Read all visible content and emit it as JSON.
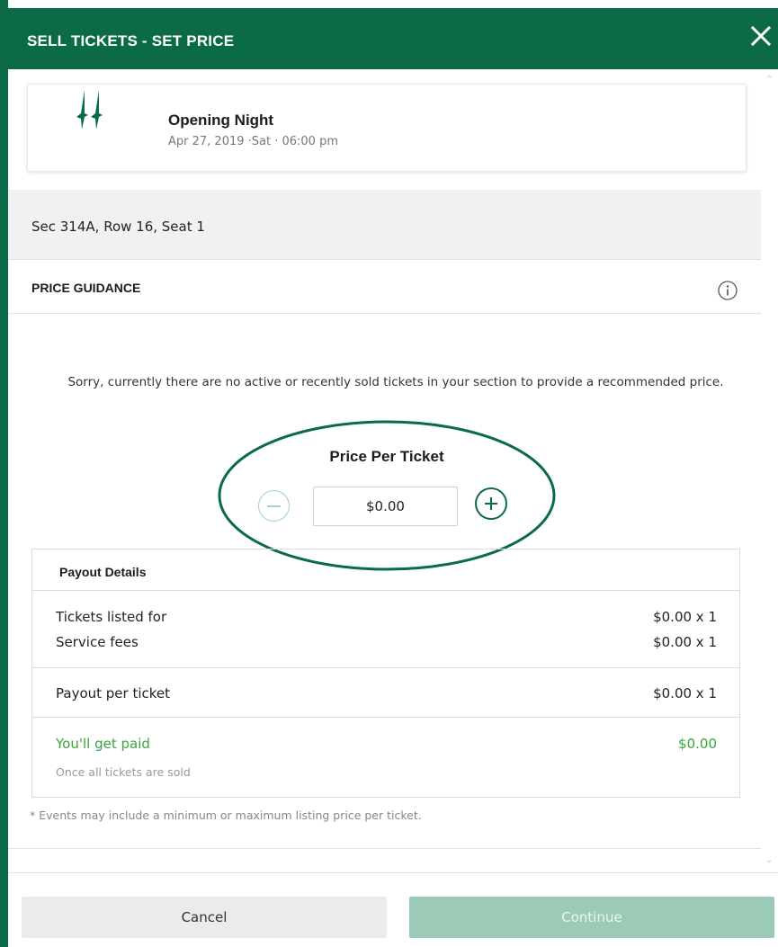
{
  "header": {
    "title": "SELL TICKETS  -  SET PRICE",
    "close_icon": "close-icon"
  },
  "event": {
    "logo": "team-logo",
    "name": "Opening Night",
    "date": "Apr 27, 2019 ·Sat · 06:00 pm"
  },
  "seat": {
    "label": "Sec 314A, Row 16, Seat 1"
  },
  "guidance": {
    "title": "PRICE GUIDANCE",
    "info_icon": "info-icon",
    "message": "Sorry, currently there are no active or recently sold tickets in your section to provide a recommended price."
  },
  "price": {
    "label": "Price Per Ticket",
    "value": "$0.00",
    "decrement_icon": "minus-circle-icon",
    "increment_icon": "plus-circle-icon"
  },
  "payout": {
    "title": "Payout Details",
    "rows": [
      {
        "label": "Tickets listed for",
        "value": "$0.00 x 1"
      },
      {
        "label": "Service fees",
        "value": "$0.00 x 1"
      },
      {
        "label": "Payout per ticket",
        "value": "$0.00 x 1"
      }
    ],
    "paid_label": "You'll get paid",
    "paid_value": "$0.00",
    "paid_note": "Once all tickets are sold"
  },
  "footnote": "* Events may include a minimum or maximum listing price per ticket.",
  "footer": {
    "cancel_label": "Cancel",
    "continue_label": "Continue"
  },
  "colors": {
    "brand_green": "#0b6b46",
    "paid_green": "#3aa63a",
    "continue_disabled": "#9bcbb7"
  }
}
